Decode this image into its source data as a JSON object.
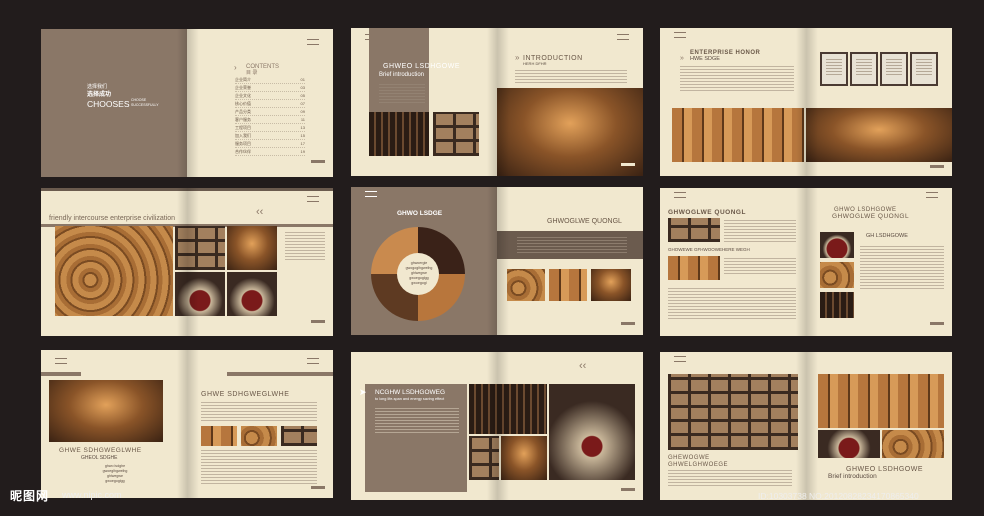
{
  "spreads": {
    "s1": {
      "cn_a": "选择我们",
      "cn_b": "选择成功",
      "chooses": "CHOOSES",
      "sub1": "CHOOSE",
      "sub2": "SUCCESSFULLY",
      "contents": "CONTENTS",
      "contents_cn": "目 录",
      "toc": [
        "企业简介",
        "企业荣誉",
        "企业文化",
        "核心价值",
        "产品分类",
        "客户服务",
        "工程项目",
        "加入我们",
        "服务项目",
        "合作伙伴"
      ],
      "nums": [
        "01",
        "03",
        "05",
        "07",
        "09",
        "11",
        "13",
        "15",
        "17",
        "19"
      ]
    },
    "s2": {
      "title": "GHWEO LSDHGOWE",
      "subtitle": "Brief introduction",
      "intro": "INTRODUCTION",
      "intro_sub": "HERH DFHR"
    },
    "s3": {
      "title": "ENTERPRISE HONOR",
      "sub": "HWE SDGE"
    },
    "s4": {
      "tagline": "friendly intercourse  enterprise civilization"
    },
    "s5": {
      "left_title": "GHWO LSDGE",
      "right_title": "GHWOGLWE QUONGL",
      "circle_lines": [
        "ghwoergle",
        "gwogoglhgwelhg",
        "ghlwegwe",
        "gwoegoglgg",
        "gwoegogl"
      ]
    },
    "s6": {
      "title_l": "GHWOGLWE QUONGL",
      "sub_l": "GHOWEWE GFHWOOWEHERE WEGH",
      "title_r1": "GHWO LSDHGOWE",
      "title_r2": "GHWOGLWE QUONGL",
      "sub_r": "GH LSDHGOWE"
    },
    "s7": {
      "right_title": "GHWE SDHGWEGLWHE",
      "left_title": "GHWE SDHGWEGLWHE",
      "left_sub": "GHEOL SDGHE",
      "lines": [
        "ghwo lsdghe",
        "gwoeglhgwelhg",
        "ghlwegwe",
        "gwoegoglgg"
      ]
    },
    "s8": {
      "title": "NCGHW LSDHGOWEG",
      "line": "to long life-span and energy saving effect"
    },
    "s9": {
      "t1": "GHEWOGWE",
      "t2": "GHWELGHWOEGE",
      "r1": "GHWEO LSDHGOWE",
      "r2": "Brief introduction"
    }
  },
  "watermark": {
    "brand": "昵图网",
    "url": "www.nipic.com",
    "id": "ID:10303738 NO:20120828234170865340"
  },
  "colors": {
    "bg": "#221c1c",
    "paper": "#f1e8cf",
    "brown": "#8a7767",
    "dark": "#6b5b4e",
    "text": "#5a4a40"
  }
}
